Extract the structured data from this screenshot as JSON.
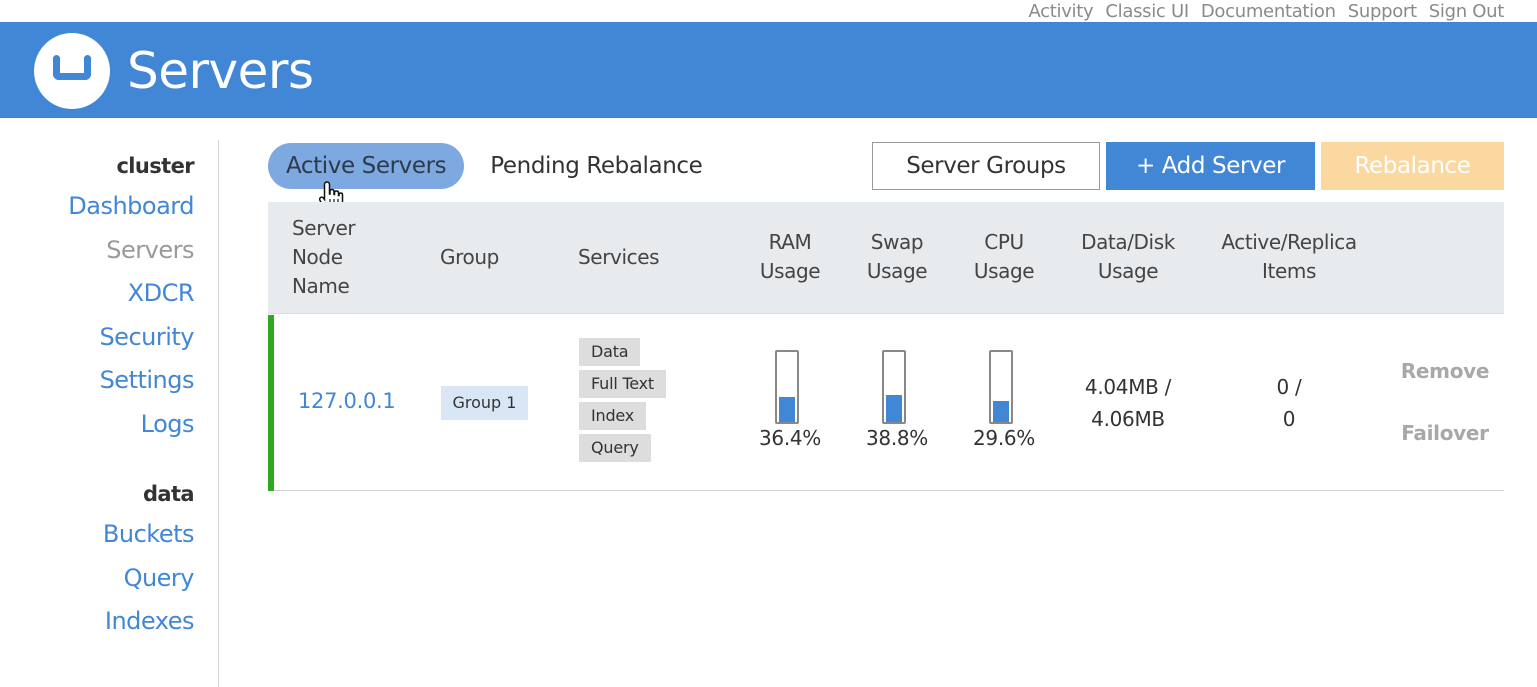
{
  "top_links": [
    "Activity",
    "Classic UI",
    "Documentation",
    "Support",
    "Sign Out"
  ],
  "header": {
    "title": "Servers",
    "logo_icon": "couchbase-logo-icon",
    "background_color": "#4287d6"
  },
  "sidebar": {
    "groups": [
      {
        "title": "cluster",
        "items": [
          {
            "label": "Dashboard",
            "active": false
          },
          {
            "label": "Servers",
            "active": true
          },
          {
            "label": "XDCR",
            "active": false
          },
          {
            "label": "Security",
            "active": false
          },
          {
            "label": "Settings",
            "active": false
          },
          {
            "label": "Logs",
            "active": false
          }
        ]
      },
      {
        "title": "data",
        "items": [
          {
            "label": "Buckets",
            "active": false
          },
          {
            "label": "Query",
            "active": false
          },
          {
            "label": "Indexes",
            "active": false
          }
        ]
      }
    ]
  },
  "tabs": [
    {
      "label": "Active Servers",
      "active": true
    },
    {
      "label": "Pending Rebalance",
      "active": false
    }
  ],
  "toolbar": {
    "server_groups_label": "Server Groups",
    "add_server_label": "+ Add Server",
    "rebalance_label": "Rebalance",
    "rebalance_disabled": true
  },
  "table": {
    "columns": {
      "name": [
        "Server",
        "Node",
        "Name"
      ],
      "group": "Group",
      "services": "Services",
      "ram": [
        "RAM",
        "Usage"
      ],
      "swap": [
        "Swap",
        "Usage"
      ],
      "cpu": [
        "CPU",
        "Usage"
      ],
      "disk": [
        "Data/Disk",
        "Usage"
      ],
      "items": [
        "Active/Replica",
        "Items"
      ]
    },
    "rows": [
      {
        "status_color": "#2ea820",
        "name": "127.0.0.1",
        "group": "Group 1",
        "services": [
          "Data",
          "Full Text",
          "Index",
          "Query"
        ],
        "ram_pct": 36.4,
        "ram_label": "36.4%",
        "swap_pct": 38.8,
        "swap_label": "38.8%",
        "cpu_pct": 29.6,
        "cpu_label": "29.6%",
        "disk": [
          "4.04MB /",
          "4.06MB"
        ],
        "items": [
          "0 /",
          "0"
        ],
        "actions": {
          "remove": "Remove",
          "failover": "Failover"
        }
      }
    ]
  }
}
